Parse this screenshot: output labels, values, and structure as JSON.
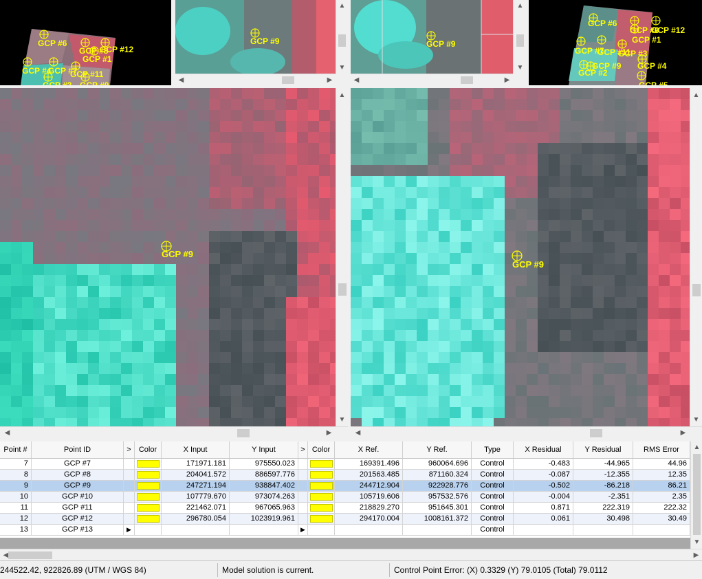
{
  "colors": {
    "gcp_marker": "#ffff00",
    "selection": "#b7d1ee"
  },
  "icons": {
    "scroll_up": "▲",
    "scroll_down": "▼",
    "scroll_left": "◀",
    "scroll_right": "▶",
    "row_pointer": "▶",
    "col_expand": ">"
  },
  "overview_left": {
    "markers": [
      {
        "label": "GCP #6"
      },
      {
        "label": "GCP #8"
      },
      {
        "label": "GCP #12"
      },
      {
        "label": "GCP #1"
      },
      {
        "label": "GCP #4"
      },
      {
        "label": "GCP #7"
      },
      {
        "label": "GCP #11"
      },
      {
        "label": "GCP #3"
      },
      {
        "label": "GCP #9"
      }
    ]
  },
  "zoom_input_small": {
    "marker_label": "GCP #9"
  },
  "zoom_ref_small": {
    "marker_label": "GCP #9"
  },
  "overview_right": {
    "markers": [
      {
        "label": "GCP #6"
      },
      {
        "label": "GCP #8"
      },
      {
        "label": "GCP #12"
      },
      {
        "label": "GCP #1"
      },
      {
        "label": "GCP #7"
      },
      {
        "label": "GCP #11"
      },
      {
        "label": "GCP #3"
      },
      {
        "label": "GCP #9"
      },
      {
        "label": "GCP #4"
      },
      {
        "label": "GCP #2"
      },
      {
        "label": "GCP #5"
      }
    ]
  },
  "main_input": {
    "marker_label": "GCP #9"
  },
  "main_ref": {
    "marker_label": "GCP #9"
  },
  "table": {
    "headers": {
      "point_num": "Point #",
      "point_id": "Point ID",
      "expand1": ">",
      "color1": "Color",
      "x_input": "X Input",
      "y_input": "Y Input",
      "expand2": ">",
      "color2": "Color",
      "x_ref": "X Ref.",
      "y_ref": "Y Ref.",
      "type": "Type",
      "x_residual": "X Residual",
      "y_residual": "Y Residual",
      "rms_error": "RMS Error"
    },
    "rows": [
      {
        "num": "7",
        "id": "GCP #7",
        "x_input": "171971.181",
        "y_input": "975550.023",
        "x_ref": "169391.496",
        "y_ref": "960064.696",
        "type": "Control",
        "x_res": "-0.483",
        "y_res": "-44.965",
        "rms": "44.96"
      },
      {
        "num": "8",
        "id": "GCP #8",
        "x_input": "204041.572",
        "y_input": "886597.776",
        "x_ref": "201563.485",
        "y_ref": "871160.324",
        "type": "Control",
        "x_res": "-0.087",
        "y_res": "-12.355",
        "rms": "12.35"
      },
      {
        "num": "9",
        "id": "GCP #9",
        "x_input": "247271.194",
        "y_input": "938847.402",
        "x_ref": "244712.904",
        "y_ref": "922928.776",
        "type": "Control",
        "x_res": "-0.502",
        "y_res": "-86.218",
        "rms": "86.21"
      },
      {
        "num": "10",
        "id": "GCP #10",
        "x_input": "107779.670",
        "y_input": "973074.263",
        "x_ref": "105719.606",
        "y_ref": "957532.576",
        "type": "Control",
        "x_res": "-0.004",
        "y_res": "-2.351",
        "rms": "2.35"
      },
      {
        "num": "11",
        "id": "GCP #11",
        "x_input": "221462.071",
        "y_input": "967065.963",
        "x_ref": "218829.270",
        "y_ref": "951645.301",
        "type": "Control",
        "x_res": "0.871",
        "y_res": "222.319",
        "rms": "222.32"
      },
      {
        "num": "12",
        "id": "GCP #12",
        "x_input": "296780.054",
        "y_input": "1023919.961",
        "x_ref": "294170.004",
        "y_ref": "1008161.372",
        "type": "Control",
        "x_res": "0.061",
        "y_res": "30.498",
        "rms": "30.49"
      },
      {
        "num": "13",
        "id": "GCP #13",
        "x_input": "",
        "y_input": "",
        "x_ref": "",
        "y_ref": "",
        "type": "Control",
        "x_res": "",
        "y_res": "",
        "rms": ""
      }
    ]
  },
  "status": {
    "coords": "244522.42, 922826.89  (UTM / WGS 84)",
    "model": "Model solution is current.",
    "error": "Control Point Error: (X) 0.3329    (Y) 79.0105    (Total) 79.0112"
  }
}
